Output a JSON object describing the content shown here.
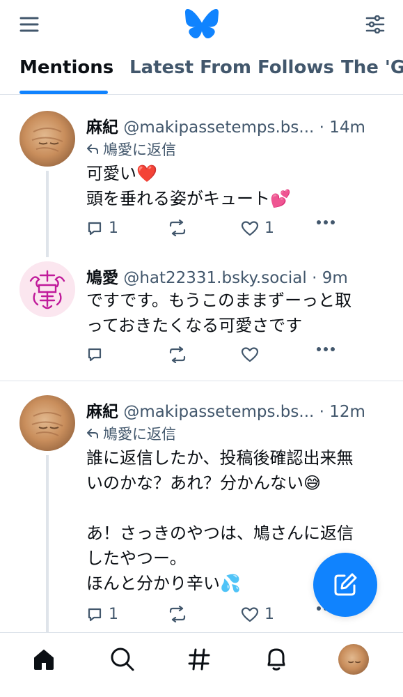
{
  "header": {
    "menu_icon": "hamburger-menu-icon",
    "logo": "butterfly-logo",
    "filter_icon": "sliders-icon",
    "brand_color": "#1083fe"
  },
  "tabs": [
    {
      "label": "Mentions",
      "active": true
    },
    {
      "label": "Latest From Follows",
      "active": false
    },
    {
      "label": "The 'G",
      "active": false
    }
  ],
  "posts": [
    {
      "name": "麻紀",
      "handle": "@makipassetemps.bs...",
      "time": "14m",
      "reply_to": "鳩愛に返信",
      "lines": [
        "可愛い❤️",
        "頭を垂れる姿がキュート💕"
      ],
      "replies": "1",
      "reposts": "",
      "likes": "1"
    },
    {
      "name": "鳩愛",
      "handle": "@hat22331.bsky.social",
      "time": "9m",
      "lines": [
        "ですです。もうこのままずーっと取",
        "っておきたくなる可愛さです"
      ],
      "replies": "",
      "reposts": "",
      "likes": ""
    },
    {
      "name": "麻紀",
      "handle": "@makipassetemps.bs...",
      "time": "12m",
      "reply_to": "鳩愛に返信",
      "lines": [
        "誰に返信したか、投稿後確認出来無",
        "いのかな？あれ？分かんない😅",
        "",
        "あ！さっきのやつは、鳩さんに返信",
        "したやつー。",
        "ほんと分かり辛い💦"
      ],
      "replies": "1",
      "reposts": "",
      "likes": "1"
    }
  ],
  "fab": {
    "icon": "compose-icon"
  },
  "bottom_nav": [
    "home-icon",
    "search-icon",
    "hashtag-icon",
    "notifications-icon",
    "profile-avatar"
  ]
}
